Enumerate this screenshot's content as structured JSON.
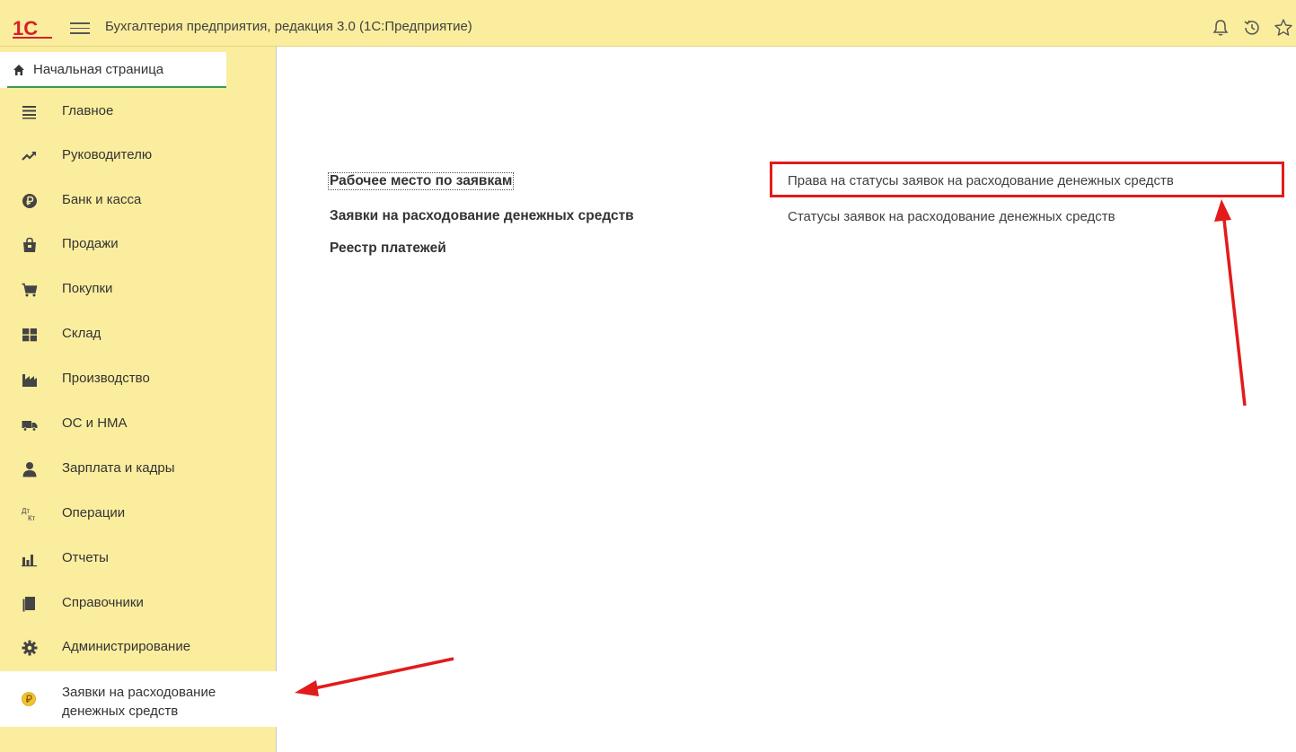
{
  "header": {
    "app_title": "Бухгалтерия предприятия, редакция 3.0  (1С:Предприятие)",
    "logo_text": "1С",
    "icons": [
      "menu-icon",
      "bell-icon",
      "history-icon",
      "star-icon"
    ]
  },
  "sidebar": {
    "home_label": "Начальная страница",
    "items": [
      {
        "label": "Главное",
        "icon": "list-icon"
      },
      {
        "label": "Руководителю",
        "icon": "trend-icon"
      },
      {
        "label": "Банк и касса",
        "icon": "ruble-coin-icon"
      },
      {
        "label": "Продажи",
        "icon": "bag-icon"
      },
      {
        "label": "Покупки",
        "icon": "cart-icon"
      },
      {
        "label": "Склад",
        "icon": "warehouse-icon"
      },
      {
        "label": "Производство",
        "icon": "factory-icon"
      },
      {
        "label": "ОС и НМА",
        "icon": "truck-icon"
      },
      {
        "label": "Зарплата и кадры",
        "icon": "person-icon"
      },
      {
        "label": "Операции",
        "icon": "dt-kt-icon",
        "icon_text_top": "Дт",
        "icon_text_bottom": "Кт"
      },
      {
        "label": "Отчеты",
        "icon": "bar-chart-icon"
      },
      {
        "label": "Справочники",
        "icon": "books-icon"
      },
      {
        "label": "Администрирование",
        "icon": "gear-icon"
      }
    ],
    "active_item": {
      "line1": "Заявки на расходование",
      "line2": "денежных средств",
      "icon": "ruble-coin-icon"
    }
  },
  "main": {
    "links_left": [
      "Рабочее место по заявкам",
      "Заявки на расходование денежных средств",
      "Реестр платежей"
    ],
    "links_right": [
      "Права на статусы заявок на расходование денежных средств",
      "Статусы заявок на расходование денежных средств"
    ]
  },
  "colors": {
    "panel_yellow": "#fbed9e",
    "annotation_red": "#e21b1b",
    "home_underline": "#3a9d53",
    "logo_red": "#d6202a"
  }
}
